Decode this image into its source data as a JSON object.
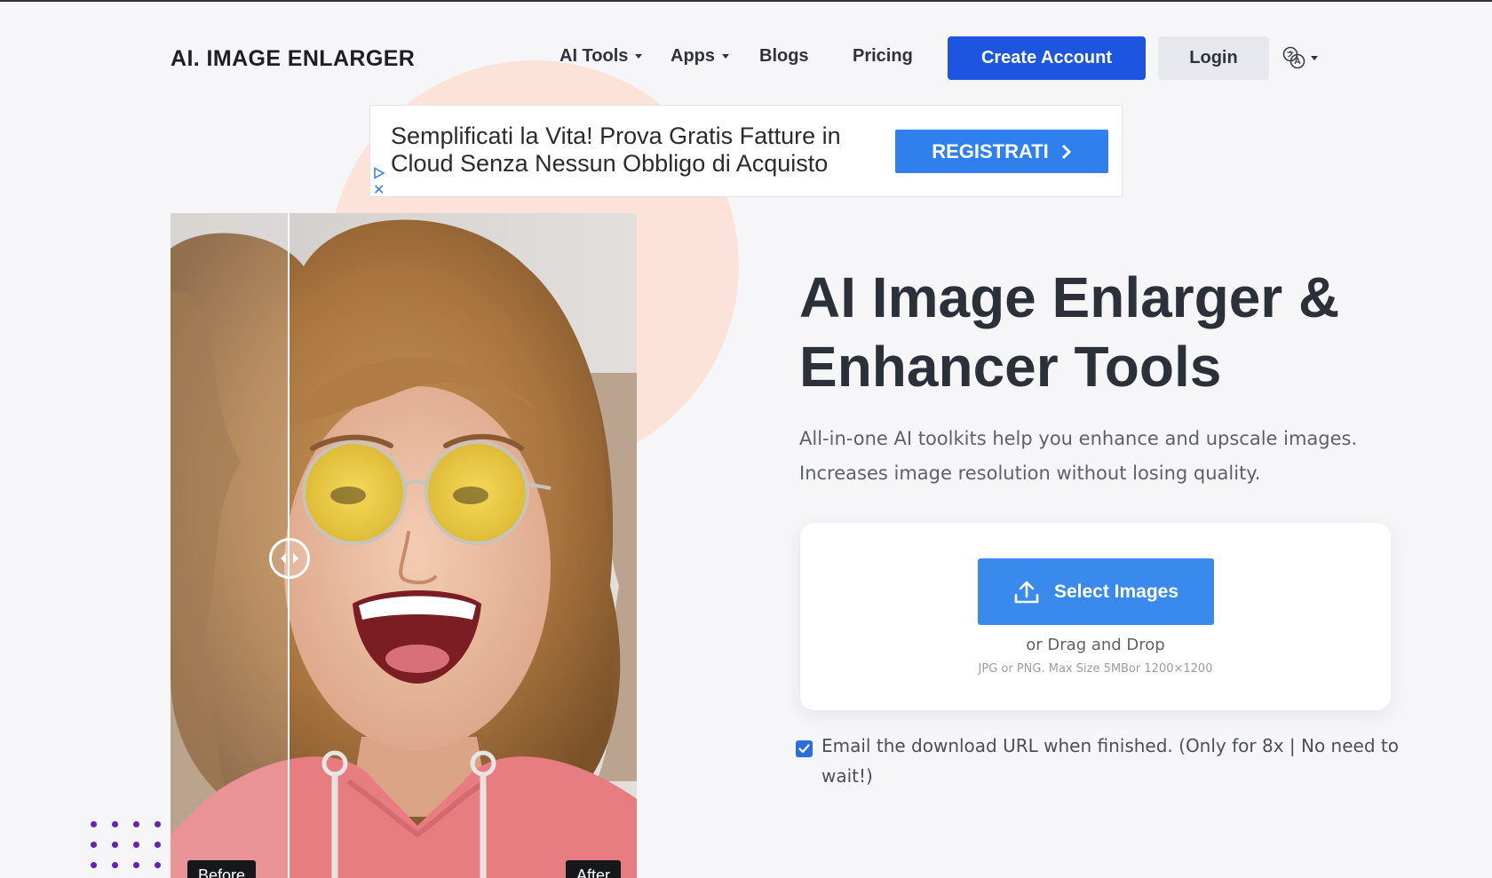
{
  "header": {
    "logo": "AI. IMAGE ENLARGER",
    "nav": {
      "ai_tools": "AI Tools",
      "apps": "Apps",
      "blogs": "Blogs",
      "pricing": "Pricing"
    },
    "create_account": "Create Account",
    "login": "Login",
    "language_icon": "translate-icon"
  },
  "ad": {
    "text_line1": "Semplificati la Vita! Prova Gratis Fatture in",
    "text_line2": "Cloud Senza Nessun Obbligo di Acquisto",
    "cta": "REGISTRATI"
  },
  "compare": {
    "before_label": "Before",
    "after_label": "After"
  },
  "hero": {
    "title_line1": "AI Image Enlarger &",
    "title_line2": "Enhancer Tools",
    "subtitle_line1": "All-in-one AI toolkits help you enhance and upscale images.",
    "subtitle_line2": "Increases image resolution without losing quality."
  },
  "upload": {
    "select_label": "Select Images",
    "drag_text": "or Drag and Drop",
    "limits": "JPG or PNG. Max Size 5MBor 1200×1200"
  },
  "email_option": {
    "checked": true,
    "label": "Email the download URL when finished. (Only for 8x | No need to wait!)"
  },
  "colors": {
    "primary": "#1d55e0",
    "select_button": "#3a8aee",
    "ad_button": "#2f7fec",
    "blob": "#fbe3d9",
    "dots": "#6a1fb6"
  }
}
